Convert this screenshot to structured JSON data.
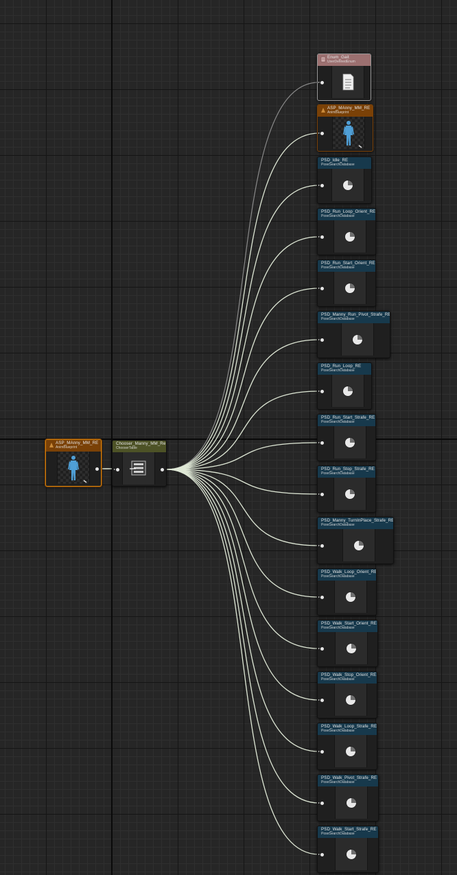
{
  "graph": {
    "source_node": {
      "name": "ASP_MAnny_MM_RE",
      "type": "AnimBlueprint",
      "icon": "character-figure-icon"
    },
    "chooser_node": {
      "name": "Chooser_Manny_MM_Re",
      "type": "ChooserTable",
      "icon": "chooser-table-icon"
    },
    "targets": [
      {
        "name": "Enum_Gait",
        "type": "UserDefinedEnum",
        "kind": "enum",
        "icon": "document-icon"
      },
      {
        "name": "ASP_MAnny_MM_RE",
        "type": "AnimBlueprint",
        "kind": "abp",
        "icon": "character-figure-icon"
      },
      {
        "name": "PSD_Idle_RE",
        "type": "PoseSearchDatabase",
        "kind": "psd",
        "icon": "pie-chart-icon"
      },
      {
        "name": "PSD_Run_Loop_Orient_RE",
        "type": "PoseSearchDatabase",
        "kind": "psd",
        "icon": "pie-chart-icon"
      },
      {
        "name": "PSD_Run_Start_Orient_RE",
        "type": "PoseSearchDatabase",
        "kind": "psd",
        "icon": "pie-chart-icon"
      },
      {
        "name": "PSD_Manny_Run_Pivot_Strafe_RE",
        "type": "PoseSearchDatabase",
        "kind": "psd",
        "icon": "pie-chart-icon"
      },
      {
        "name": "PSD_Run_Loop_RE",
        "type": "PoseSearchDatabase",
        "kind": "psd",
        "icon": "pie-chart-icon"
      },
      {
        "name": "PSD_Run_Start_Strafe_RE",
        "type": "PoseSearchDatabase",
        "kind": "psd",
        "icon": "pie-chart-icon"
      },
      {
        "name": "PSD_Run_Stop_Strafe_RE",
        "type": "PoseSearchDatabase",
        "kind": "psd",
        "icon": "pie-chart-icon"
      },
      {
        "name": "PSD_Manny_TurnInPlace_Strafe_RE",
        "type": "PoseSearchDatabase",
        "kind": "psd",
        "icon": "pie-chart-icon"
      },
      {
        "name": "PSD_Walk_Loop_Orient_RE",
        "type": "PoseSearchDatabase",
        "kind": "psd",
        "icon": "pie-chart-icon"
      },
      {
        "name": "PSD_Walk_Start_Orient_RE",
        "type": "PoseSearchDatabase",
        "kind": "psd",
        "icon": "pie-chart-icon"
      },
      {
        "name": "PSD_Walk_Stop_Orient_RE",
        "type": "PoseSearchDatabase",
        "kind": "psd",
        "icon": "pie-chart-icon"
      },
      {
        "name": "PSD_Walk_Loop_Strafe_RE",
        "type": "PoseSearchDatabase",
        "kind": "psd",
        "icon": "pie-chart-icon"
      },
      {
        "name": "PSD_Walk_Pivot_Strafe_RE",
        "type": "PoseSearchDatabase",
        "kind": "psd",
        "icon": "pie-chart-icon"
      },
      {
        "name": "PSD_Walk_Start_Strafe_RE",
        "type": "PoseSearchDatabase",
        "kind": "psd",
        "icon": "pie-chart-icon"
      }
    ],
    "colors": {
      "psd_header": "#17394c",
      "animblueprint_header": "#7a4107",
      "enum_header": "#9c7070",
      "chooser_header": "#4d5226",
      "wire": "#dfe8d6",
      "enum_wire": "#8a8a8a"
    }
  }
}
